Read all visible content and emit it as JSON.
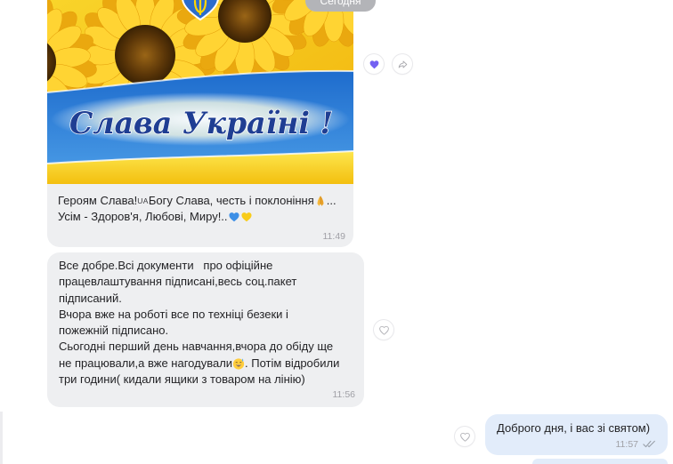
{
  "colors": {
    "page_bg": "#ffffff",
    "incoming_bubble": "#eeeff1",
    "outgoing_bubble": "#e2ecfa",
    "message_text": "#232326",
    "time_text": "#a0a0a6",
    "date_badge": "#b3b4b8",
    "reaction_purple": "#7360f2"
  },
  "date_divider": {
    "label": "Сегодня"
  },
  "messages": [
    {
      "outgoing": false,
      "image": {
        "slogan": "Слава Україні !",
        "emblem_icon": "ukraine-heart-shield-icon"
      },
      "caption": {
        "line1": {
          "part1": "Героям Слава!",
          "flag": "UA",
          "part2": "Богу Слава, честь і поклоніння",
          "emoji": "folded-hands-emoji",
          "part3": "..."
        },
        "line2": {
          "part1": "Усім - Здоров'я, Любові, Миру!..",
          "emojis": [
            "blue-heart-emoji",
            "yellow-heart-emoji"
          ]
        }
      },
      "time": "11:49",
      "reactions": {
        "like_icon": "heart-filled-icon",
        "liked": true,
        "share_icon": "share-icon"
      }
    },
    {
      "outgoing": false,
      "lines": [
        "Все добре.Всі документи   про офіційне",
        "працевлаштування підписані,весь соц.пакет",
        "підписаний.",
        "Вчора вже на роботі все по техніці безеки і",
        "пожежній підписано.",
        "Сьогодні перший день навчання,вчора до обіду ще",
        {
          "before": "не працювали,а вже нагодували",
          "emoji": "sweat-smile-emoji",
          "after": ". Потім відробили"
        },
        "три години( кидали ящики з товаром на лінію)"
      ],
      "time": "11:56",
      "reactions": {
        "like_icon": "heart-outline-icon",
        "liked": false
      }
    },
    {
      "outgoing": true,
      "text": "Доброго дня, і вас зі святом)",
      "time": "11:57",
      "status_icon": "double-check-icon",
      "reactions": {
        "like_icon": "heart-outline-icon",
        "liked": false
      }
    }
  ]
}
